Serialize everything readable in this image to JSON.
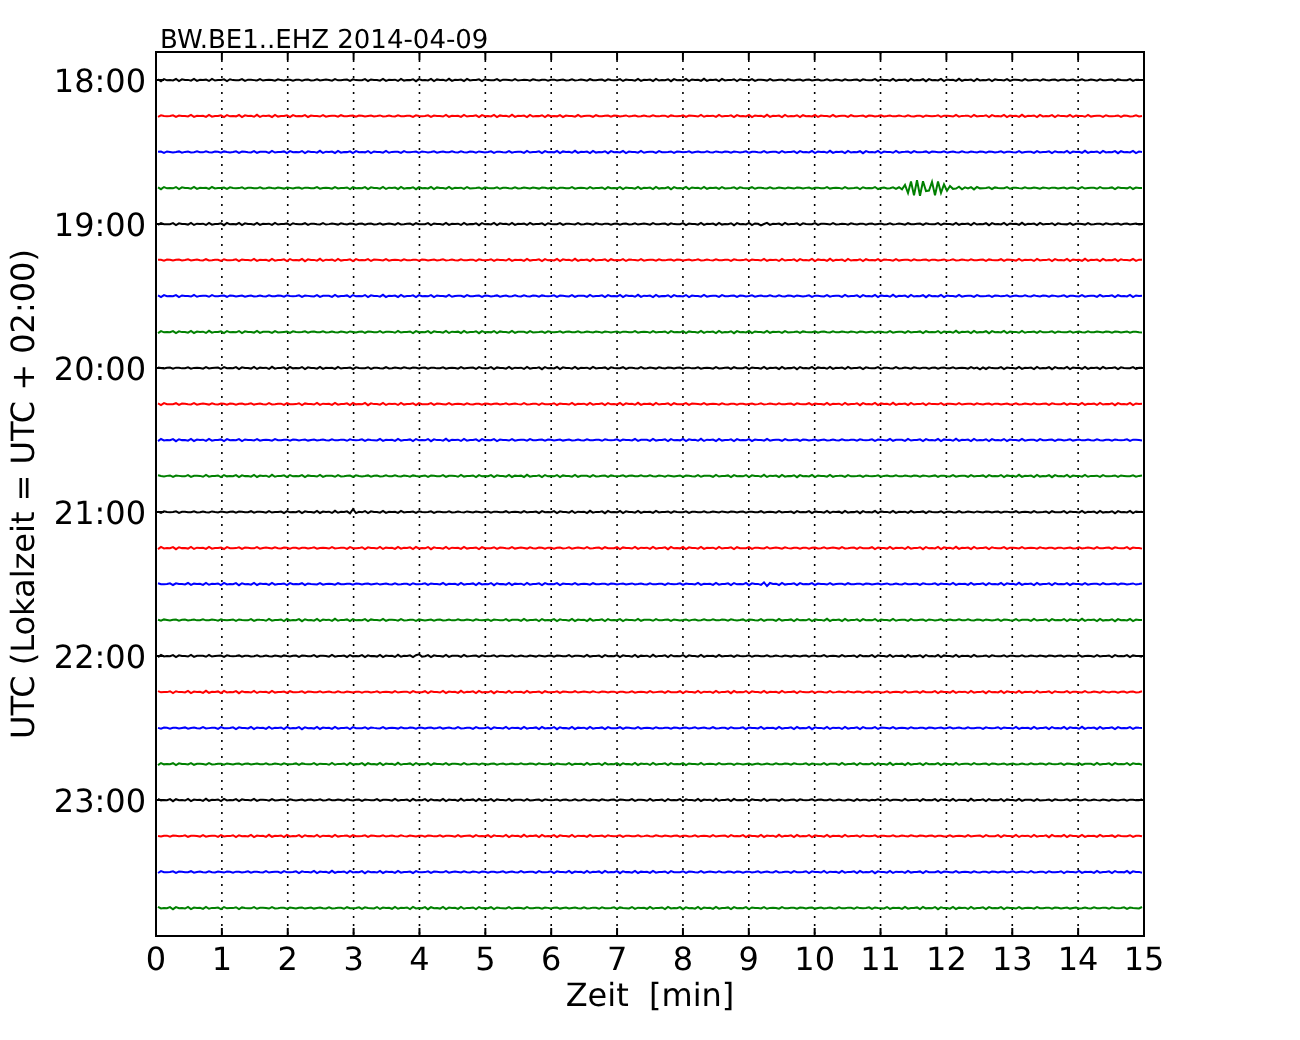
{
  "title": "BW.BE1..EHZ 2014-04-09",
  "xlabel": "Zeit  [min]",
  "ylabel": "UTC (Lokalzeit = UTC + 02:00)",
  "xticks": [
    "0",
    "1",
    "2",
    "3",
    "4",
    "5",
    "6",
    "7",
    "8",
    "9",
    "10",
    "11",
    "12",
    "13",
    "14",
    "15"
  ],
  "yticks": [
    "18:00",
    "19:00",
    "20:00",
    "21:00",
    "22:00",
    "23:00"
  ],
  "traces": [
    {
      "color": "#000000"
    },
    {
      "color": "#ff0000"
    },
    {
      "color": "#0000ff"
    },
    {
      "color": "#008000"
    },
    {
      "color": "#000000"
    },
    {
      "color": "#ff0000"
    },
    {
      "color": "#0000ff"
    },
    {
      "color": "#008000"
    },
    {
      "color": "#000000"
    },
    {
      "color": "#ff0000"
    },
    {
      "color": "#0000ff"
    },
    {
      "color": "#008000"
    },
    {
      "color": "#000000"
    },
    {
      "color": "#ff0000"
    },
    {
      "color": "#0000ff"
    },
    {
      "color": "#008000"
    },
    {
      "color": "#000000"
    },
    {
      "color": "#ff0000"
    },
    {
      "color": "#0000ff"
    },
    {
      "color": "#008000"
    },
    {
      "color": "#000000"
    },
    {
      "color": "#ff0000"
    },
    {
      "color": "#0000ff"
    },
    {
      "color": "#008000"
    }
  ]
}
